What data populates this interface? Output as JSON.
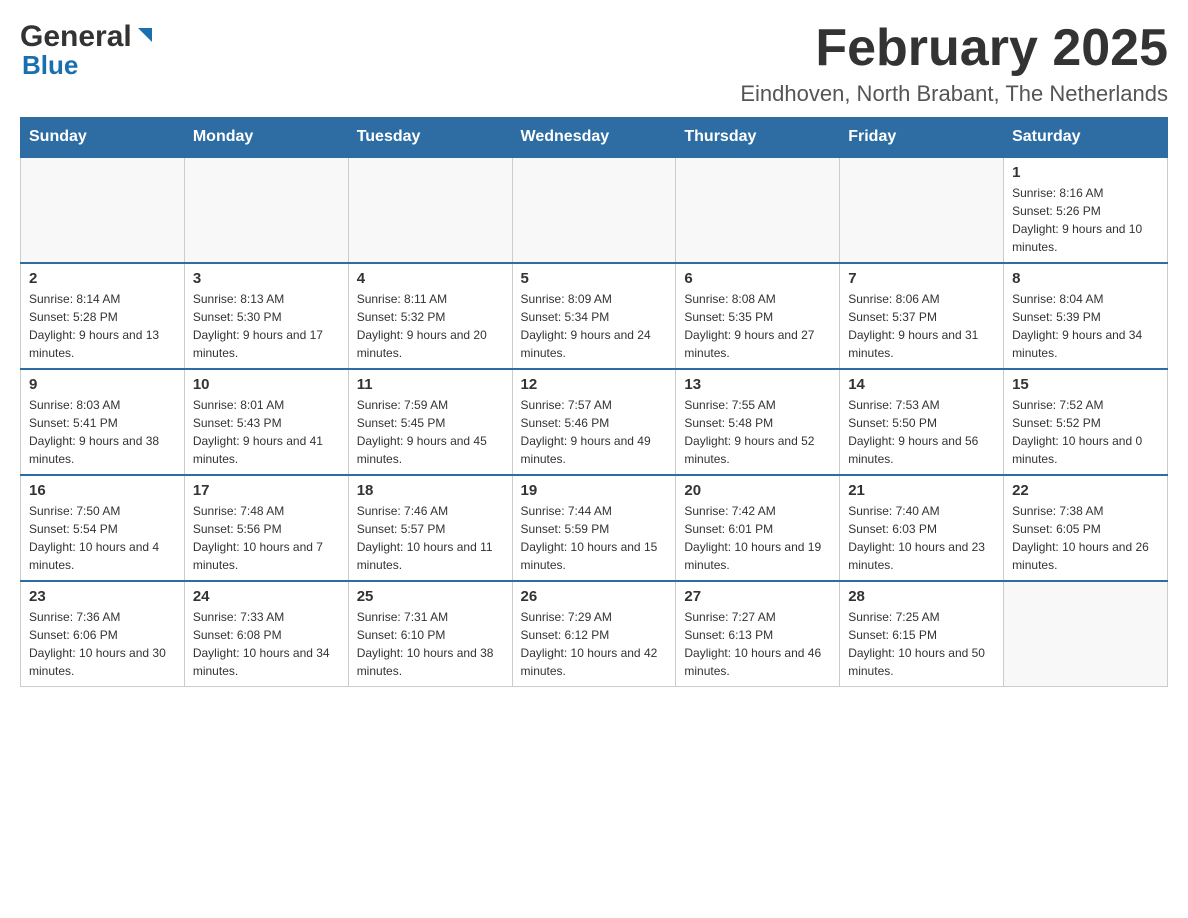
{
  "header": {
    "logo_general": "General",
    "logo_blue": "Blue",
    "month_title": "February 2025",
    "location": "Eindhoven, North Brabant, The Netherlands"
  },
  "days_of_week": [
    "Sunday",
    "Monday",
    "Tuesday",
    "Wednesday",
    "Thursday",
    "Friday",
    "Saturday"
  ],
  "weeks": [
    [
      {
        "day": "",
        "info": ""
      },
      {
        "day": "",
        "info": ""
      },
      {
        "day": "",
        "info": ""
      },
      {
        "day": "",
        "info": ""
      },
      {
        "day": "",
        "info": ""
      },
      {
        "day": "",
        "info": ""
      },
      {
        "day": "1",
        "info": "Sunrise: 8:16 AM\nSunset: 5:26 PM\nDaylight: 9 hours and 10 minutes."
      }
    ],
    [
      {
        "day": "2",
        "info": "Sunrise: 8:14 AM\nSunset: 5:28 PM\nDaylight: 9 hours and 13 minutes."
      },
      {
        "day": "3",
        "info": "Sunrise: 8:13 AM\nSunset: 5:30 PM\nDaylight: 9 hours and 17 minutes."
      },
      {
        "day": "4",
        "info": "Sunrise: 8:11 AM\nSunset: 5:32 PM\nDaylight: 9 hours and 20 minutes."
      },
      {
        "day": "5",
        "info": "Sunrise: 8:09 AM\nSunset: 5:34 PM\nDaylight: 9 hours and 24 minutes."
      },
      {
        "day": "6",
        "info": "Sunrise: 8:08 AM\nSunset: 5:35 PM\nDaylight: 9 hours and 27 minutes."
      },
      {
        "day": "7",
        "info": "Sunrise: 8:06 AM\nSunset: 5:37 PM\nDaylight: 9 hours and 31 minutes."
      },
      {
        "day": "8",
        "info": "Sunrise: 8:04 AM\nSunset: 5:39 PM\nDaylight: 9 hours and 34 minutes."
      }
    ],
    [
      {
        "day": "9",
        "info": "Sunrise: 8:03 AM\nSunset: 5:41 PM\nDaylight: 9 hours and 38 minutes."
      },
      {
        "day": "10",
        "info": "Sunrise: 8:01 AM\nSunset: 5:43 PM\nDaylight: 9 hours and 41 minutes."
      },
      {
        "day": "11",
        "info": "Sunrise: 7:59 AM\nSunset: 5:45 PM\nDaylight: 9 hours and 45 minutes."
      },
      {
        "day": "12",
        "info": "Sunrise: 7:57 AM\nSunset: 5:46 PM\nDaylight: 9 hours and 49 minutes."
      },
      {
        "day": "13",
        "info": "Sunrise: 7:55 AM\nSunset: 5:48 PM\nDaylight: 9 hours and 52 minutes."
      },
      {
        "day": "14",
        "info": "Sunrise: 7:53 AM\nSunset: 5:50 PM\nDaylight: 9 hours and 56 minutes."
      },
      {
        "day": "15",
        "info": "Sunrise: 7:52 AM\nSunset: 5:52 PM\nDaylight: 10 hours and 0 minutes."
      }
    ],
    [
      {
        "day": "16",
        "info": "Sunrise: 7:50 AM\nSunset: 5:54 PM\nDaylight: 10 hours and 4 minutes."
      },
      {
        "day": "17",
        "info": "Sunrise: 7:48 AM\nSunset: 5:56 PM\nDaylight: 10 hours and 7 minutes."
      },
      {
        "day": "18",
        "info": "Sunrise: 7:46 AM\nSunset: 5:57 PM\nDaylight: 10 hours and 11 minutes."
      },
      {
        "day": "19",
        "info": "Sunrise: 7:44 AM\nSunset: 5:59 PM\nDaylight: 10 hours and 15 minutes."
      },
      {
        "day": "20",
        "info": "Sunrise: 7:42 AM\nSunset: 6:01 PM\nDaylight: 10 hours and 19 minutes."
      },
      {
        "day": "21",
        "info": "Sunrise: 7:40 AM\nSunset: 6:03 PM\nDaylight: 10 hours and 23 minutes."
      },
      {
        "day": "22",
        "info": "Sunrise: 7:38 AM\nSunset: 6:05 PM\nDaylight: 10 hours and 26 minutes."
      }
    ],
    [
      {
        "day": "23",
        "info": "Sunrise: 7:36 AM\nSunset: 6:06 PM\nDaylight: 10 hours and 30 minutes."
      },
      {
        "day": "24",
        "info": "Sunrise: 7:33 AM\nSunset: 6:08 PM\nDaylight: 10 hours and 34 minutes."
      },
      {
        "day": "25",
        "info": "Sunrise: 7:31 AM\nSunset: 6:10 PM\nDaylight: 10 hours and 38 minutes."
      },
      {
        "day": "26",
        "info": "Sunrise: 7:29 AM\nSunset: 6:12 PM\nDaylight: 10 hours and 42 minutes."
      },
      {
        "day": "27",
        "info": "Sunrise: 7:27 AM\nSunset: 6:13 PM\nDaylight: 10 hours and 46 minutes."
      },
      {
        "day": "28",
        "info": "Sunrise: 7:25 AM\nSunset: 6:15 PM\nDaylight: 10 hours and 50 minutes."
      },
      {
        "day": "",
        "info": ""
      }
    ]
  ]
}
